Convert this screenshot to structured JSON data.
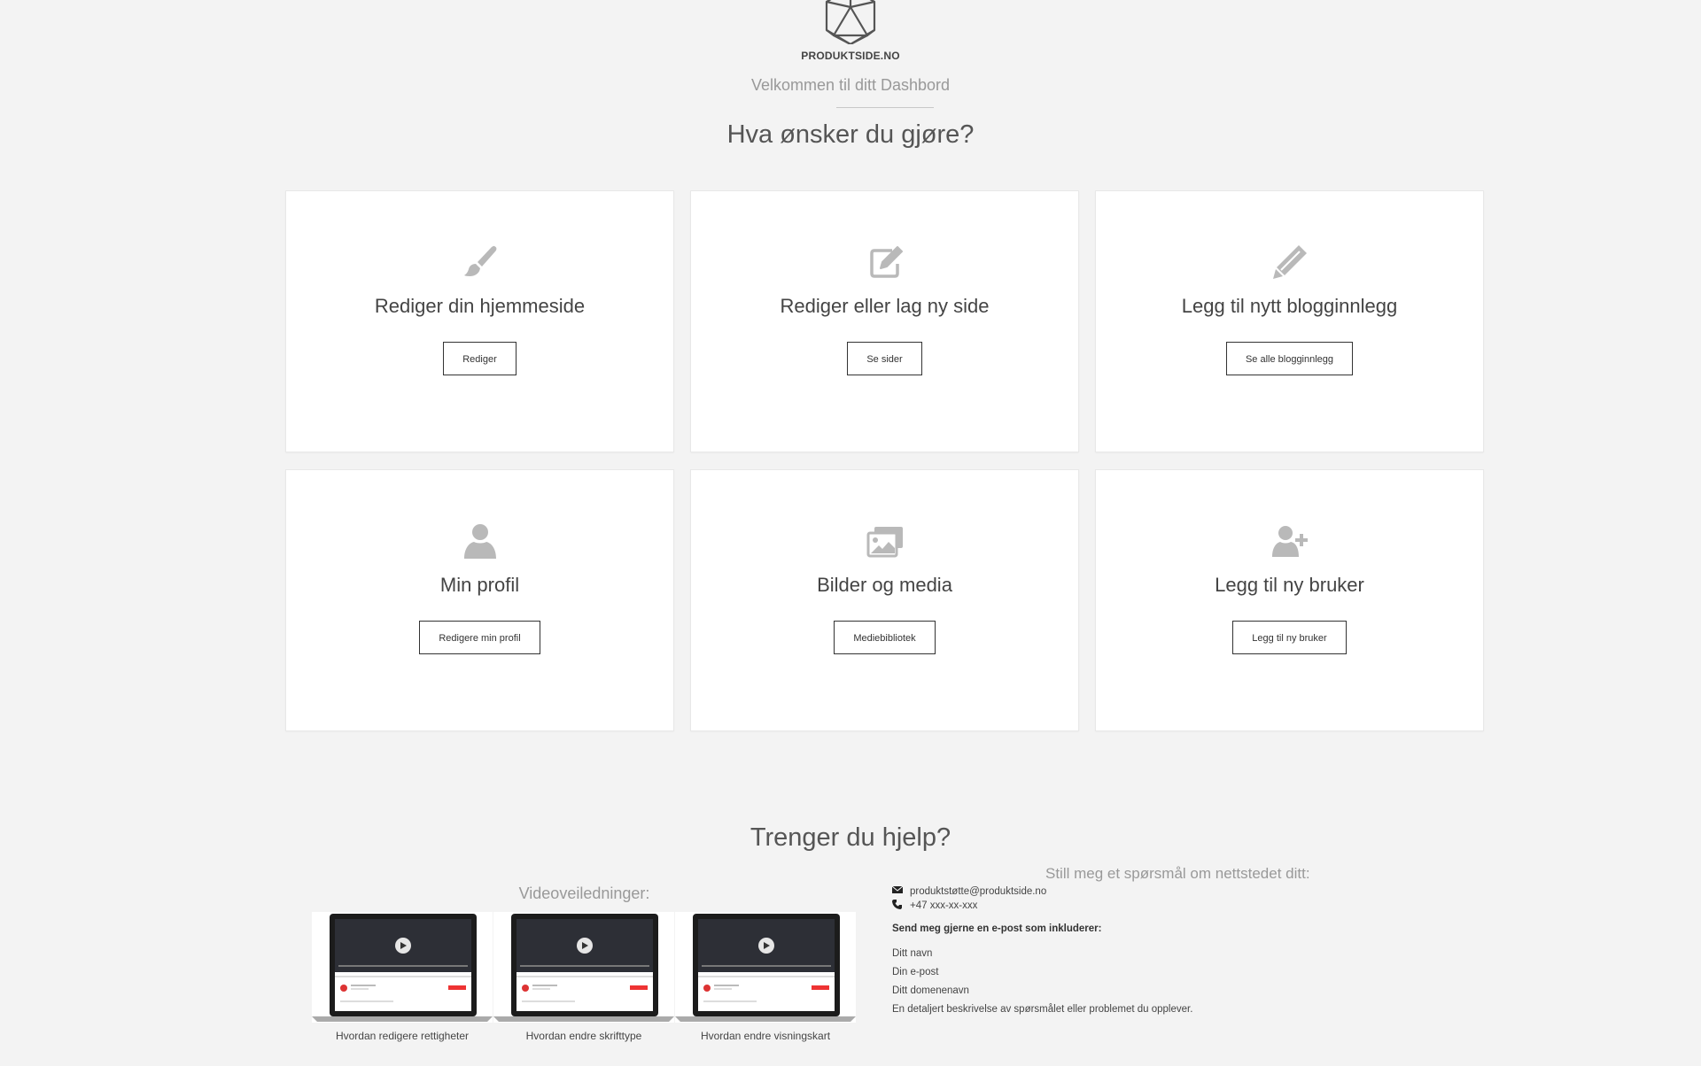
{
  "header": {
    "brand": "PRODUKTSIDE.NO",
    "welcome": "Velkommen til ditt Dashbord",
    "heading": "Hva ønsker du gjøre?"
  },
  "cards": [
    {
      "icon": "paint-brush-icon",
      "title": "Rediger din hjemmeside",
      "button": "Rediger"
    },
    {
      "icon": "edit-icon",
      "title": "Rediger eller lag ny side",
      "button": "Se sider"
    },
    {
      "icon": "pencil-icon",
      "title": "Legg til nytt blogginnlegg",
      "button": "Se alle blogginnlegg"
    },
    {
      "icon": "user-icon",
      "title": "Min profil",
      "button": "Redigere min profil"
    },
    {
      "icon": "images-icon",
      "title": "Bilder og media",
      "button": "Mediebibliotek"
    },
    {
      "icon": "user-plus-icon",
      "title": "Legg til ny bruker",
      "button": "Legg til ny bruker"
    }
  ],
  "help": {
    "heading": "Trenger du hjelp?",
    "video_label": "Videoveiledninger:",
    "videos": [
      {
        "caption": "Hvordan redigere rettigheter"
      },
      {
        "caption": "Hvordan endre skrifttype"
      },
      {
        "caption": "Hvordan endre visningskart"
      }
    ],
    "ask_label": "Still meg et spørsmål om nettstedet ditt:",
    "email": "produktstøtte@produktside.no",
    "phone": "+47 xxx-xx-xxx",
    "info_heading": "Send meg gjerne en e-post som inkluderer:",
    "info_items": [
      "Ditt navn",
      "Din e-post",
      "Ditt domenenavn",
      "En detaljert beskrivelse av spørsmålet eller problemet du opplever."
    ]
  },
  "colors": {
    "background": "#f3f3f3",
    "card": "#ffffff",
    "icon": "#b9b9b9",
    "text": "#444444",
    "muted": "#999999"
  }
}
